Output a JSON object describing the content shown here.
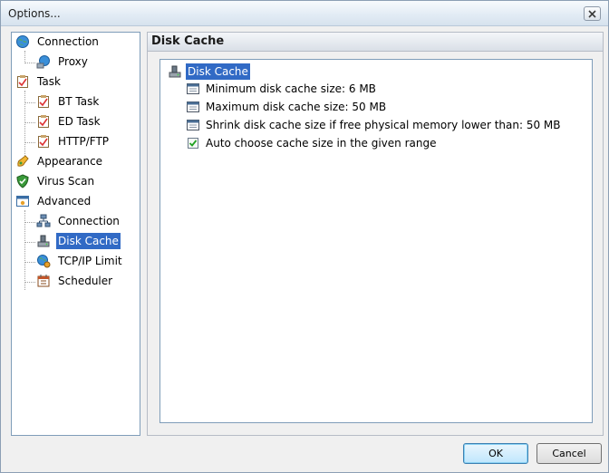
{
  "window": {
    "title": "Options...",
    "close_icon": "close-icon"
  },
  "sidebar": {
    "items": [
      {
        "label": "Connection",
        "icon": "globe-icon",
        "level": 0
      },
      {
        "label": "Proxy",
        "icon": "network-globe-icon",
        "level": 1
      },
      {
        "label": "Task",
        "icon": "clipboard-icon",
        "level": 0
      },
      {
        "label": "BT Task",
        "icon": "clipboard-icon",
        "level": 1
      },
      {
        "label": "ED Task",
        "icon": "clipboard-icon",
        "level": 1
      },
      {
        "label": "HTTP/FTP",
        "icon": "clipboard-icon",
        "level": 1
      },
      {
        "label": "Appearance",
        "icon": "paint-icon",
        "level": 0
      },
      {
        "label": "Virus Scan",
        "icon": "shield-icon",
        "level": 0
      },
      {
        "label": "Advanced",
        "icon": "settings-window-icon",
        "level": 0
      },
      {
        "label": "Connection",
        "icon": "network-icon",
        "level": 1
      },
      {
        "label": "Disk Cache",
        "icon": "disk-icon",
        "level": 1,
        "selected": true
      },
      {
        "label": "TCP/IP Limit",
        "icon": "globe-gear-icon",
        "level": 1
      },
      {
        "label": "Scheduler",
        "icon": "calendar-icon",
        "level": 1
      }
    ]
  },
  "main": {
    "section_title": "Disk Cache",
    "root_label": "Disk Cache",
    "settings": [
      {
        "label": "Minimum disk cache size: 6 MB",
        "icon": "setting-icon"
      },
      {
        "label": "Maximum disk cache size: 50 MB",
        "icon": "setting-icon"
      },
      {
        "label": "Shrink disk cache size if free physical memory lower than: 50 MB",
        "icon": "setting-icon"
      },
      {
        "label": "Auto choose cache size in the given range",
        "icon": "checkbox-checked-icon",
        "checked": true
      }
    ]
  },
  "buttons": {
    "ok": "OK",
    "cancel": "Cancel"
  },
  "colors": {
    "selection": "#316ac5",
    "border": "#7f9db9",
    "background": "#f0f0f0"
  }
}
